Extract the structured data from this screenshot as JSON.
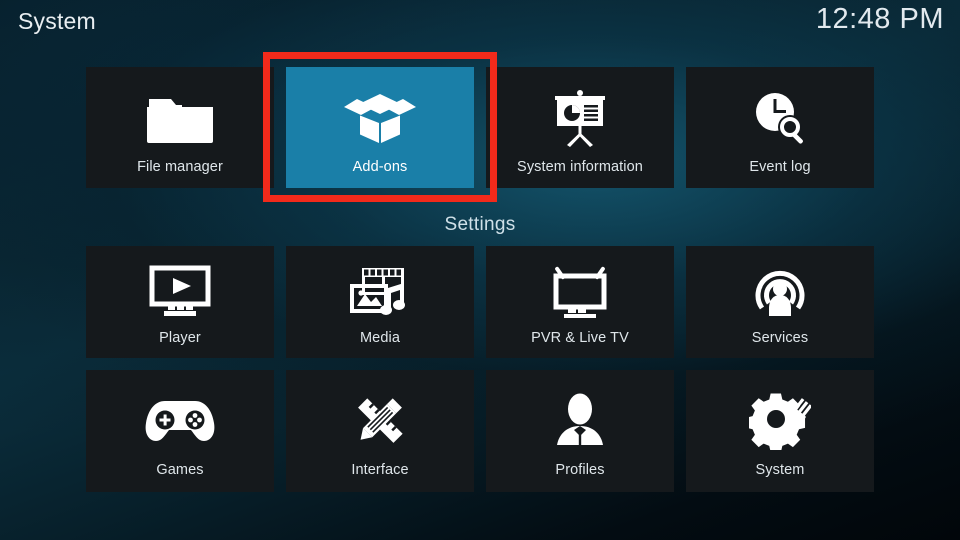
{
  "header": {
    "title": "System",
    "clock": "12:48 PM"
  },
  "theme": {
    "selection_blue": "#1a7fa8",
    "annotation_red": "#f22a1b",
    "tile_bg": "#15191c",
    "text": "#dfe6ea"
  },
  "sections": {
    "settings_heading": "Settings"
  },
  "top_row": {
    "tiles": [
      {
        "label": "File manager",
        "icon": "folder-icon",
        "selected": false
      },
      {
        "label": "Add-ons",
        "icon": "open-box-icon",
        "selected": true
      },
      {
        "label": "System information",
        "icon": "presentation-icon",
        "selected": false
      },
      {
        "label": "Event log",
        "icon": "clock-search-icon",
        "selected": false
      }
    ]
  },
  "settings_row_1": {
    "tiles": [
      {
        "label": "Player",
        "icon": "monitor-play-icon",
        "selected": false
      },
      {
        "label": "Media",
        "icon": "film-photo-music-icon",
        "selected": false
      },
      {
        "label": "PVR & Live TV",
        "icon": "tv-antenna-icon",
        "selected": false
      },
      {
        "label": "Services",
        "icon": "broadcast-person-icon",
        "selected": false
      }
    ]
  },
  "settings_row_2": {
    "tiles": [
      {
        "label": "Games",
        "icon": "gamepad-icon",
        "selected": false
      },
      {
        "label": "Interface",
        "icon": "pencil-ruler-icon",
        "selected": false
      },
      {
        "label": "Profiles",
        "icon": "person-bust-icon",
        "selected": false
      },
      {
        "label": "System",
        "icon": "gear-wrench-icon",
        "selected": false
      }
    ]
  }
}
